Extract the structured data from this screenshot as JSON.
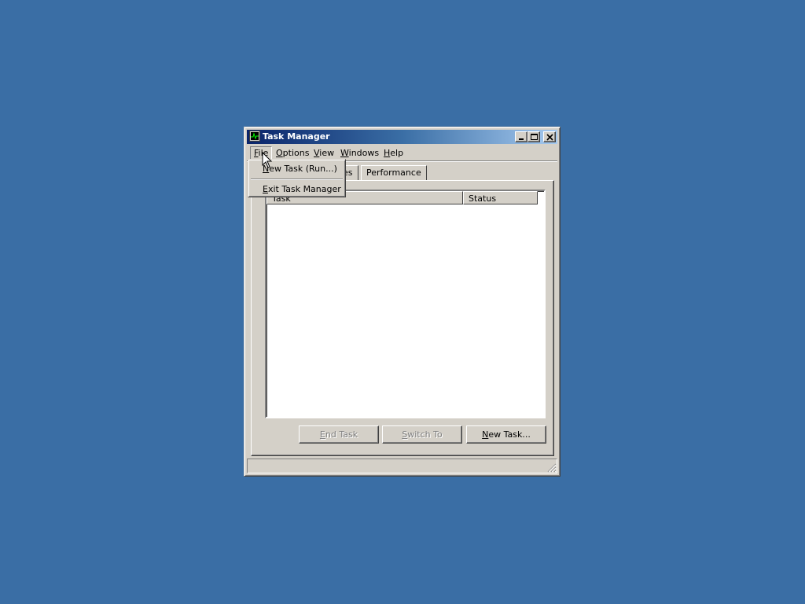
{
  "window": {
    "title": "Task Manager",
    "icon": "task-manager-icon",
    "controls": [
      "minimize-icon",
      "maximize-icon",
      "close-icon"
    ]
  },
  "menubar": {
    "items": [
      {
        "label": "File",
        "mnemonic": "F",
        "rest": "ile",
        "active": true
      },
      {
        "label": "Options",
        "mnemonic": "O",
        "rest": "ptions"
      },
      {
        "label": "View",
        "mnemonic": "V",
        "rest": "iew"
      },
      {
        "label": "Windows",
        "mnemonic": "W",
        "rest": "indows"
      },
      {
        "label": "Help",
        "mnemonic": "H",
        "rest": "elp"
      }
    ]
  },
  "file_menu": {
    "items": [
      {
        "label": "New Task (Run...)",
        "mnemonic": "N",
        "rest": "ew Task (Run...)"
      },
      {
        "label": "Exit Task Manager",
        "mnemonic": "E",
        "rest": "xit Task Manager"
      }
    ]
  },
  "tabs": [
    {
      "label": "es",
      "partially_hidden": true
    },
    {
      "label": "Performance"
    }
  ],
  "task_list": {
    "columns": [
      "Task",
      "Status"
    ],
    "rows": []
  },
  "buttons": {
    "end_task": {
      "label": "End Task",
      "mnemonic": "E",
      "rest": "nd Task",
      "enabled": false
    },
    "switch_to": {
      "label": "Switch To",
      "mnemonic": "S",
      "rest": "witch To",
      "enabled": false
    },
    "new_task": {
      "label": "New Task...",
      "mnemonic": "N",
      "rest": "ew Task...",
      "enabled": true
    }
  },
  "colors": {
    "desktop": "#3a6ea5",
    "face": "#d4d0c8",
    "title_start": "#0a246a",
    "title_end": "#a6caf0"
  }
}
